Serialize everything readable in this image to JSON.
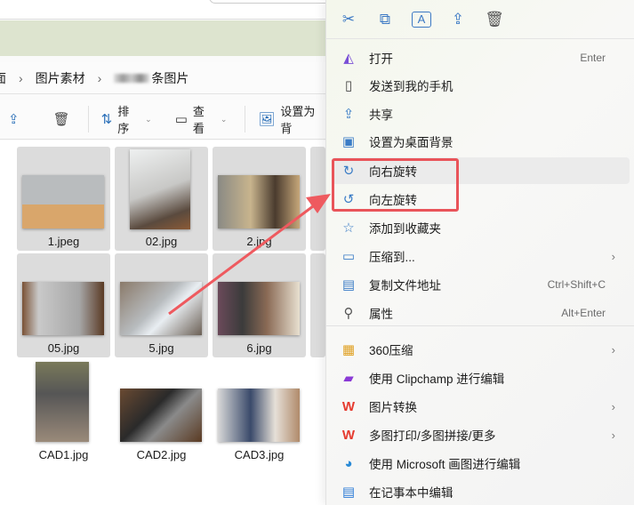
{
  "breadcrumb": {
    "items": [
      "面",
      "图片素材",
      "条图片"
    ]
  },
  "toolbar": {
    "sort": "排序",
    "view": "查看",
    "set_bg": "设置为背"
  },
  "files": [
    {
      "name": "1.jpeg",
      "selected": true
    },
    {
      "name": "02.jpg",
      "selected": true
    },
    {
      "name": "2.jpg",
      "selected": true
    },
    {
      "name": "05.jpg",
      "selected": true
    },
    {
      "name": "5.jpg",
      "selected": true
    },
    {
      "name": "6.jpg",
      "selected": true
    },
    {
      "name": "CAD1.jpg",
      "selected": false
    },
    {
      "name": "CAD2.jpg",
      "selected": false
    },
    {
      "name": "CAD3.jpg",
      "selected": false
    }
  ],
  "context_menu": {
    "quick_actions": [
      "cut",
      "copy",
      "rename",
      "share",
      "delete"
    ],
    "items": [
      {
        "label": "打开",
        "shortcut": "Enter",
        "icon": "photos-icon"
      },
      {
        "label": "发送到我的手机",
        "icon": "phone-icon"
      },
      {
        "label": "共享",
        "icon": "share-icon"
      },
      {
        "label": "设置为桌面背景",
        "icon": "wallpaper-icon"
      },
      {
        "label": "向右旋转",
        "icon": "rotate-right-icon"
      },
      {
        "label": "向左旋转",
        "icon": "rotate-left-icon"
      },
      {
        "label": "添加到收藏夹",
        "icon": "star-icon"
      },
      {
        "label": "压缩到...",
        "icon": "zip-folder-icon"
      },
      {
        "label": "复制文件地址",
        "shortcut": "Ctrl+Shift+C",
        "icon": "copy-path-icon"
      },
      {
        "label": "属性",
        "shortcut": "Alt+Enter",
        "icon": "wrench-icon"
      },
      {
        "label": "360压缩",
        "icon": "360zip-icon"
      },
      {
        "label": "使用 Clipchamp 进行编辑",
        "icon": "clipchamp-icon"
      },
      {
        "label": "图片转换",
        "icon": "wps-icon"
      },
      {
        "label": "多图打印/多图拼接/更多",
        "icon": "wps-icon"
      },
      {
        "label": "使用 Microsoft 画图进行编辑",
        "icon": "paint-icon"
      },
      {
        "label": "在记事本中编辑",
        "icon": "notepad-icon"
      }
    ]
  },
  "colors": {
    "accent": "#3a7cc6",
    "annotation": "#e9545a"
  }
}
